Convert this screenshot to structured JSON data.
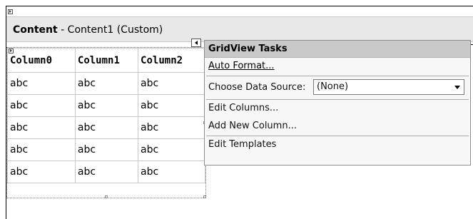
{
  "content_region": {
    "title_bold": "Content",
    "title_rest": " - Content1 (Custom)"
  },
  "grid": {
    "columns": [
      "Column0",
      "Column1",
      "Column2"
    ],
    "rows": [
      [
        "abc",
        "abc",
        "abc"
      ],
      [
        "abc",
        "abc",
        "abc"
      ],
      [
        "abc",
        "abc",
        "abc"
      ],
      [
        "abc",
        "abc",
        "abc"
      ],
      [
        "abc",
        "abc",
        "abc"
      ]
    ]
  },
  "tasks_panel": {
    "title": "GridView Tasks",
    "auto_format": "Auto Format...",
    "choose_data_source_label": "Choose Data Source:",
    "data_source_value": "(None)",
    "edit_columns": "Edit Columns...",
    "add_new_column": "Add New Column...",
    "edit_templates": "Edit Templates"
  },
  "icons": {
    "smart_tag_collapse": "collapse-arrow-icon",
    "dropdown": "chevron-down-icon",
    "glyph": "expand-glyph-icon"
  }
}
